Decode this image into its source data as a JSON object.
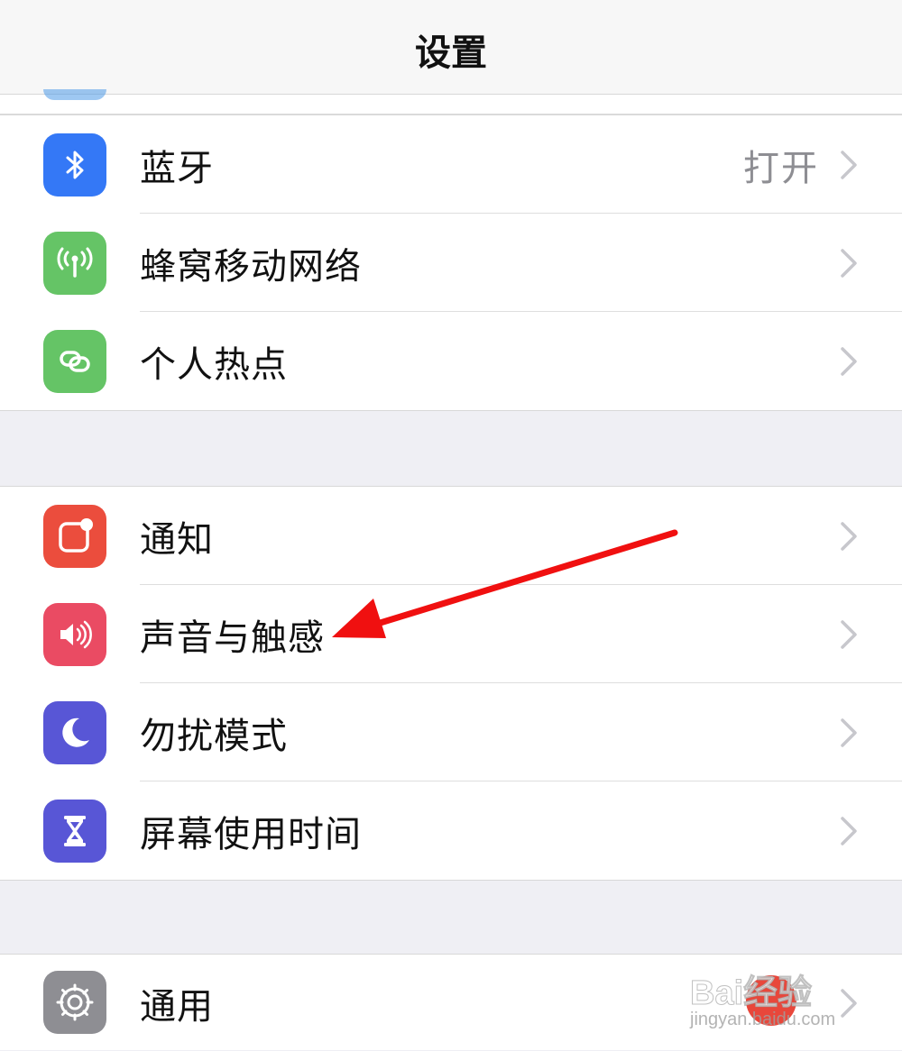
{
  "navbar": {
    "title": "设置"
  },
  "group1": [
    {
      "label": "蓝牙",
      "value": "打开",
      "icon": "bluetooth-icon",
      "color": "#3478f6"
    },
    {
      "label": "蜂窝移动网络",
      "icon": "cellular-antenna-icon",
      "color": "#65c466"
    },
    {
      "label": "个人热点",
      "icon": "hotspot-link-icon",
      "color": "#65c466"
    }
  ],
  "group2": [
    {
      "label": "通知",
      "icon": "notifications-icon",
      "color": "#eb4d3d"
    },
    {
      "label": "声音与触感",
      "icon": "speaker-icon",
      "color": "#ea4b63"
    },
    {
      "label": "勿扰模式",
      "icon": "moon-icon",
      "color": "#5856d6"
    },
    {
      "label": "屏幕使用时间",
      "icon": "hourglass-icon",
      "color": "#5856d6"
    }
  ],
  "group3": [
    {
      "label": "通用",
      "icon": "gear-icon",
      "color": "#8e8e93"
    }
  ],
  "annotation": {
    "arrow_color": "#f01010"
  },
  "watermark": {
    "text": "Bai经验",
    "sub": "jingyan.baidu.com"
  }
}
